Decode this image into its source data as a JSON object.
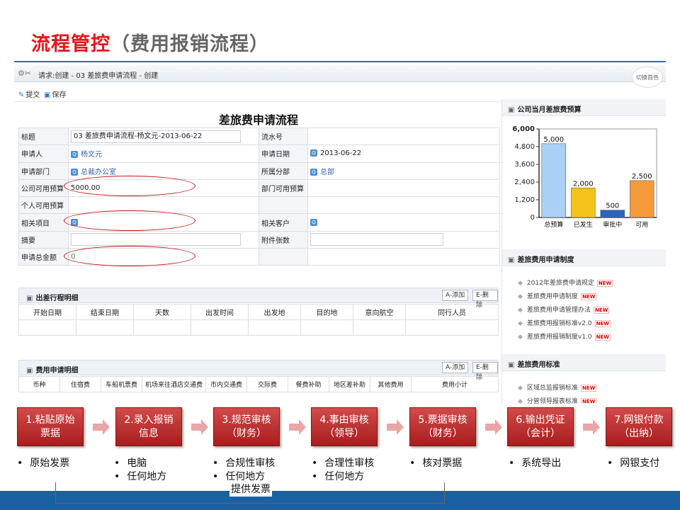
{
  "slide": {
    "title_main": "流程管控",
    "title_sub": "（费用报销流程）"
  },
  "window": {
    "title": "请求:创建 - 03 差旅费申请流程 - 创建",
    "switch_label": "切换首色"
  },
  "toolbar": {
    "submit_label": "提交",
    "save_label": "保存"
  },
  "form": {
    "title": "差旅费申请流程",
    "rows": [
      {
        "l1": "标题",
        "v1": "03 差旅费申请流程-杨文元-2013-06-22",
        "l2": "流水号",
        "v2": ""
      },
      {
        "l1": "申请人",
        "v1": "杨文元",
        "l2": "申请日期",
        "v2": "2013-06-22"
      },
      {
        "l1": "申请部门",
        "v1": "总裁办公室",
        "l2": "所属分部",
        "v2": "总部"
      },
      {
        "l1": "公司可用预算",
        "v1": "5000.00",
        "l2": "部门可用预算",
        "v2": ""
      },
      {
        "l1": "个人可用预算",
        "v1": "",
        "l2": "",
        "v2": ""
      },
      {
        "l1": "相关项目",
        "v1": "",
        "l2": "相关客户",
        "v2": ""
      },
      {
        "l1": "摘要",
        "v1": "",
        "l2": "附件张数",
        "v2": ""
      },
      {
        "l1": "申请总金额",
        "v1": "0",
        "l2": "",
        "v2": ""
      }
    ]
  },
  "trip": {
    "title": "出差行程明细",
    "add_label": "A-添加",
    "del_label": "E-删除",
    "columns": [
      "开始日期",
      "结束日期",
      "天数",
      "出发时间",
      "出发地",
      "目的地",
      "意向航空",
      "同行人员"
    ]
  },
  "expense": {
    "title": "费用申请明细",
    "add_label": "A-添加",
    "del_label": "E-删除",
    "columns": [
      "币种",
      "住宿费",
      "车船机票费",
      "机场来往酒店交通费",
      "市内交通费",
      "交际费",
      "餐费补助",
      "地区差补助",
      "其他费用",
      "费用小计"
    ]
  },
  "right_panel": {
    "budget_title": "公司当月差旅费预算",
    "policy_title": "差旅费用申请制度",
    "policy_items": [
      "2012年差旅费申请规定",
      "差旅费用申请制度",
      "差旅费用申请管理办法",
      "差旅费用报销标准v2.0",
      "差旅费用报销制度v1.0"
    ],
    "standard_title": "差旅费用标准",
    "standard_items": [
      "区域总监报销标准",
      "分管领导报表标准"
    ],
    "new_badge": "NEW"
  },
  "chart_data": {
    "type": "bar",
    "categories": [
      "总预算",
      "已发生",
      "审批中",
      "可用"
    ],
    "values": [
      5000,
      2000,
      500,
      2500
    ],
    "value_labels": [
      "5,000",
      "2,000",
      "500",
      "2,500"
    ],
    "yticks": [
      "6,000",
      "4,800",
      "3,600",
      "2,400",
      "1,200",
      "0"
    ],
    "ylim": [
      0,
      6000
    ],
    "colors": [
      "#a9d0f5",
      "#f5c21b",
      "#2b64b8",
      "#f59a3b"
    ]
  },
  "flow": {
    "steps": [
      {
        "line1": "1.粘贴原始",
        "line2": "票据"
      },
      {
        "line1": "2.录入报销",
        "line2": "信息"
      },
      {
        "line1": "3.规范审核",
        "line2": "（财务）"
      },
      {
        "line1": "4.事由审核",
        "line2": "（领导）"
      },
      {
        "line1": "5.票据审核",
        "line2": "（财务）"
      },
      {
        "line1": "6.输出凭证",
        "line2": "（会计）"
      },
      {
        "line1": "7.网银付款",
        "line2": "（出纳）"
      }
    ],
    "bullets": [
      [
        "原始发票"
      ],
      [
        "电脑",
        "任何地方"
      ],
      [
        "合规性审核",
        "任何地方"
      ],
      [
        "合理性审核",
        "任何地方"
      ],
      [
        "核对票据"
      ],
      [
        "系统导出"
      ],
      [
        "网银支付"
      ]
    ],
    "extra_note": "提供发票"
  }
}
